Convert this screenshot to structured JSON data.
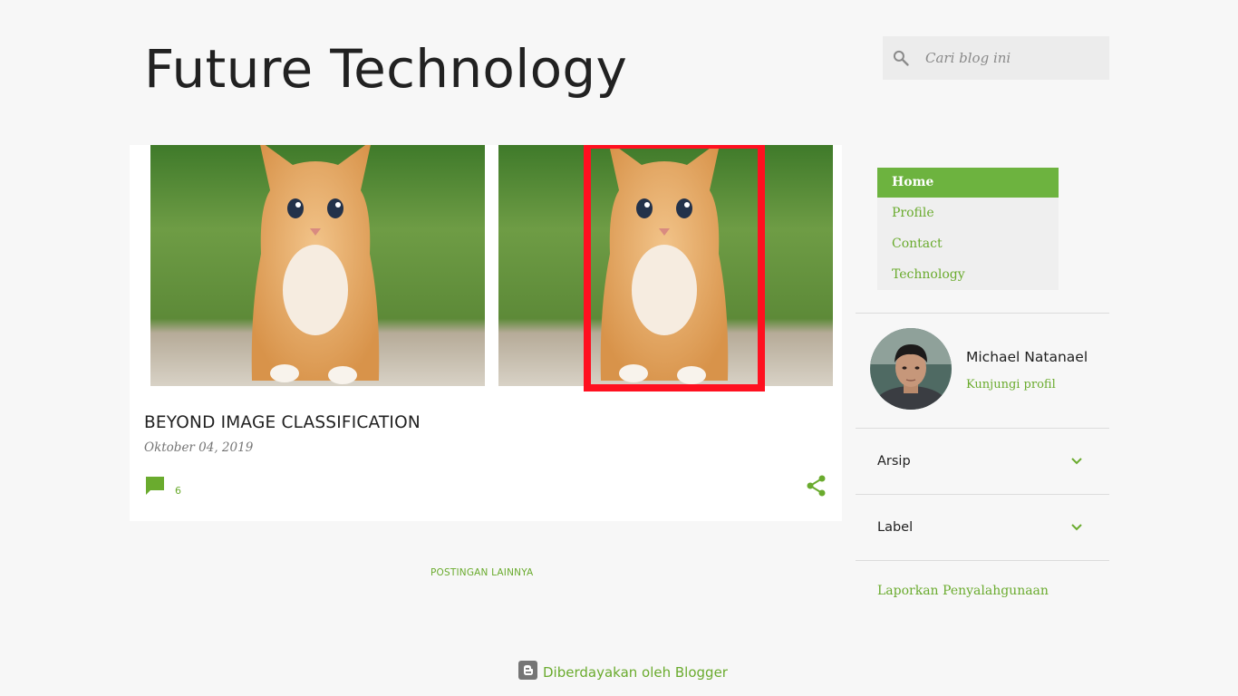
{
  "header": {
    "blog_title": "Future Technology"
  },
  "search": {
    "placeholder": "Cari blog ini"
  },
  "post": {
    "title": "BEYOND IMAGE CLASSIFICATION",
    "date": "Oktober 04, 2019",
    "comment_count": "6"
  },
  "more_posts": "POSTINGAN LAINNYA",
  "pages_menu": {
    "items": [
      {
        "label": "Home",
        "active": true
      },
      {
        "label": "Profile"
      },
      {
        "label": "Contact"
      },
      {
        "label": "Technology"
      }
    ]
  },
  "profile": {
    "name": "Michael Natanael",
    "visit_label": "Kunjungi profil"
  },
  "archive": {
    "label": "Arsip"
  },
  "labels": {
    "label": "Label"
  },
  "report_abuse": "Laporkan Penyalahgunaan",
  "footer": {
    "powered_by": "Diberdayakan oleh Blogger"
  },
  "colors": {
    "accent": "#6aab2e",
    "menu_active": "#6db33f",
    "background": "#f7f7f7",
    "detection_box": "#ff1020"
  },
  "icons": {
    "search": "search-icon",
    "comment": "comment-icon",
    "share": "share-icon",
    "chevron": "chevron-down-icon",
    "blogger": "blogger-logo-icon"
  }
}
